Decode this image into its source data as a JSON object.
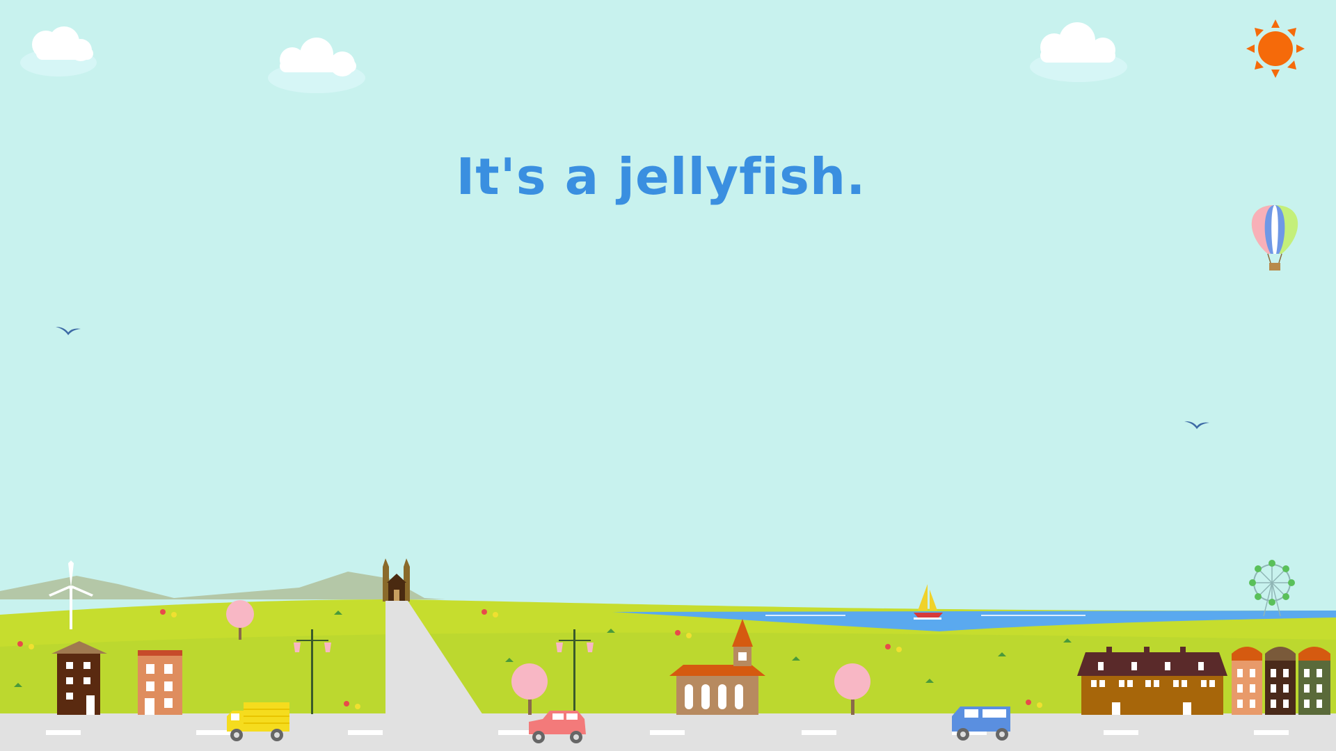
{
  "slide": {
    "text": "It's a jellyfish."
  },
  "colors": {
    "sky": "#c8f2ee",
    "text": "#3a8fe0",
    "grass": "#b5d92e",
    "sea": "#5aa9ef",
    "road": "#e1e1e1",
    "sun": "#f56a0a"
  },
  "icons": [
    "sun-icon",
    "cloud-icon",
    "hot-air-balloon-icon",
    "bird-icon",
    "wind-turbine-icon",
    "sailboat-icon",
    "ferris-wheel-icon",
    "truck-icon",
    "car-icon",
    "van-icon",
    "tree-icon",
    "street-lamp-icon",
    "house-icon",
    "church-icon",
    "castle-icon"
  ]
}
